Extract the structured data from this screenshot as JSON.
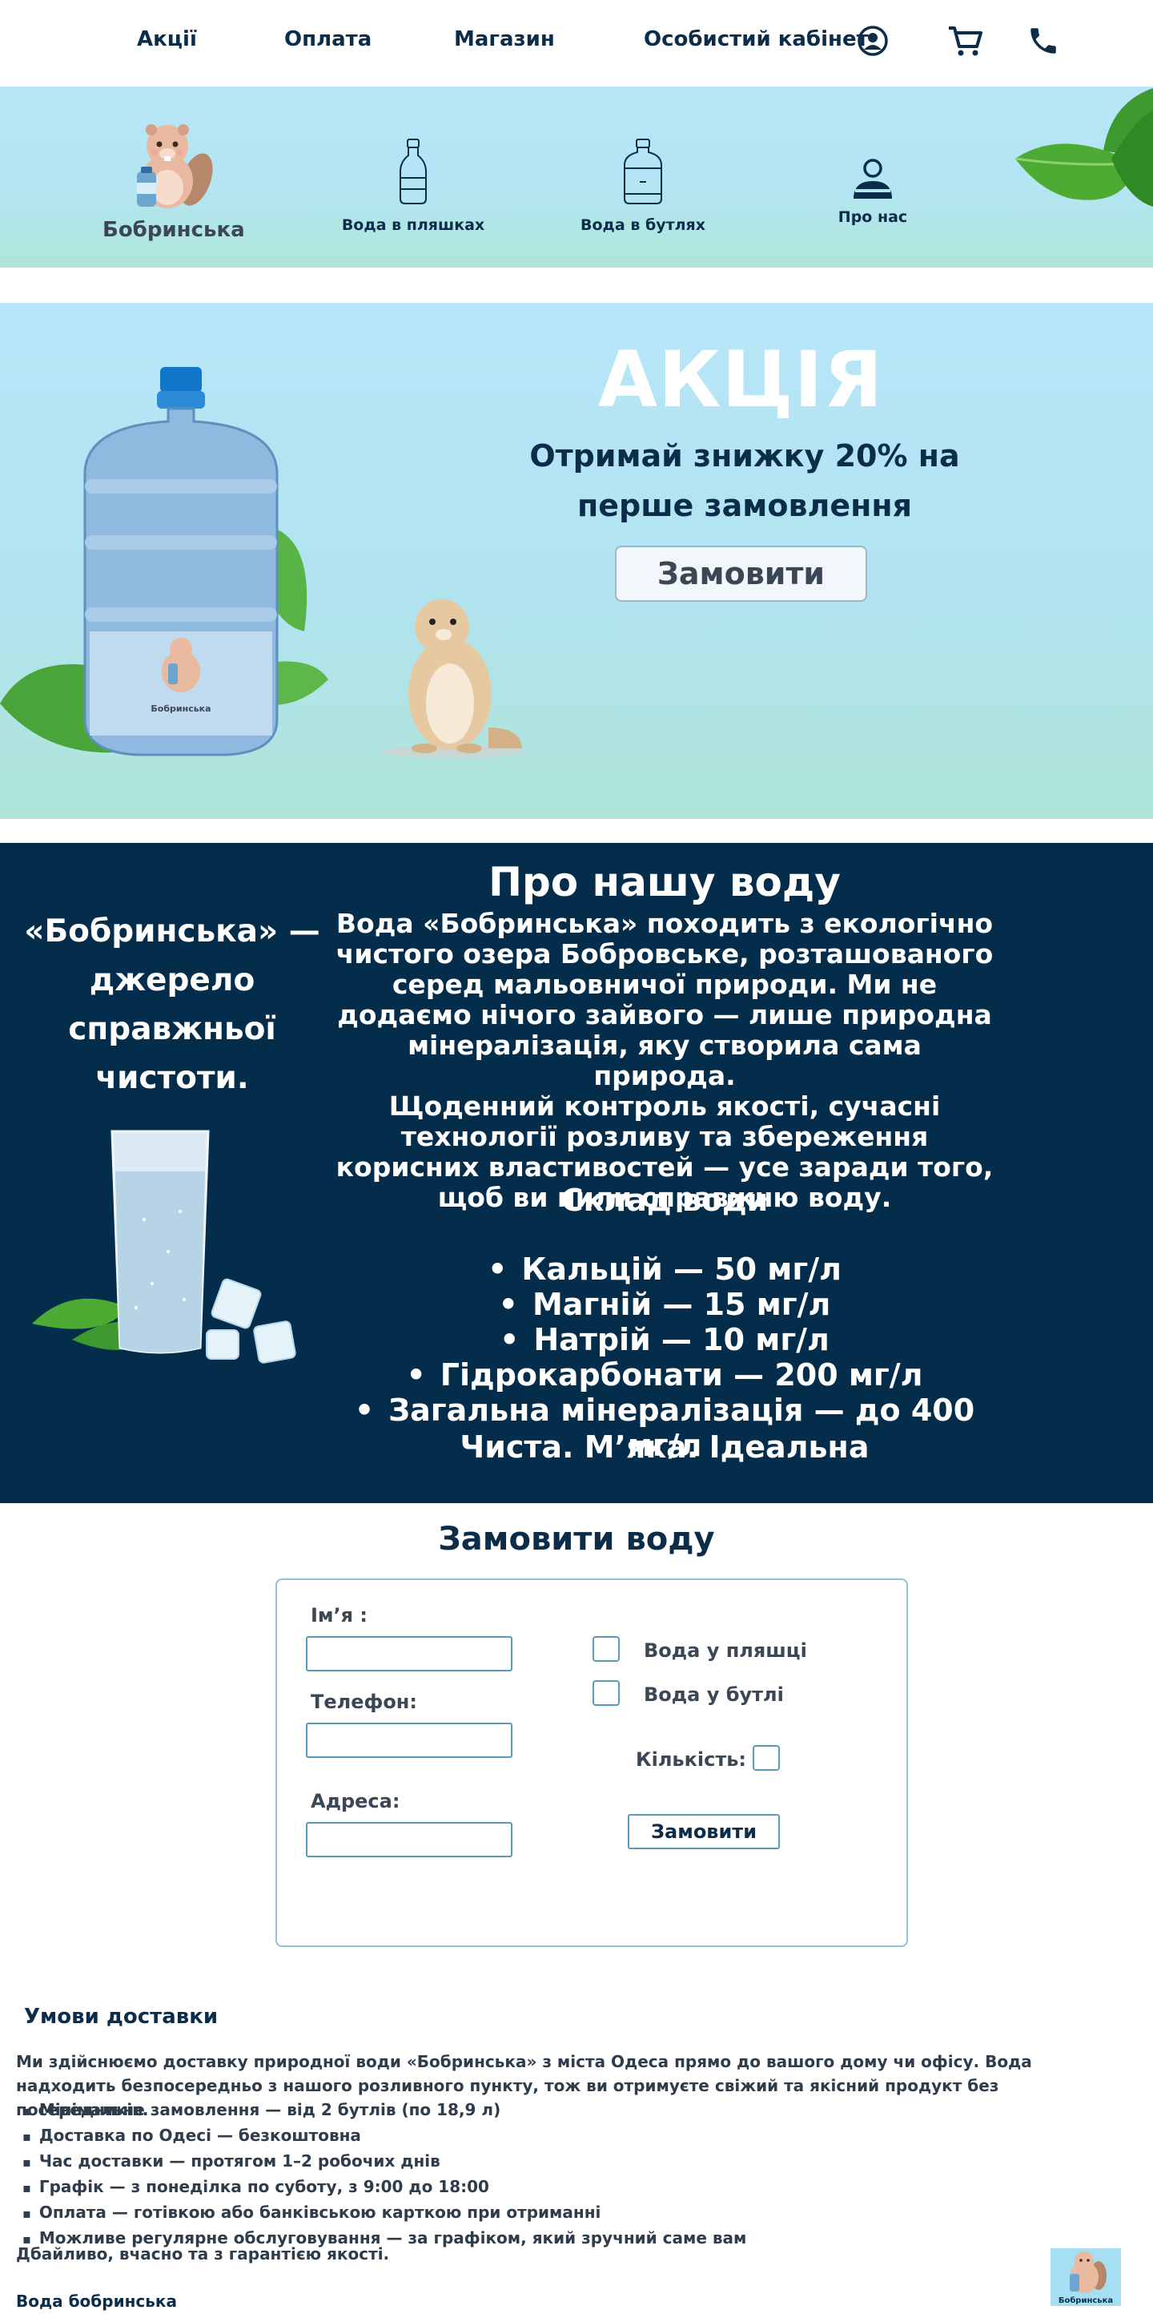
{
  "nav": {
    "links": [
      "Акції",
      "Оплата",
      "Магазин",
      "Особистий кабінет"
    ],
    "icons": [
      "account-icon",
      "cart-icon",
      "phone-icon"
    ]
  },
  "categories": {
    "brand": "Бобринська",
    "items": [
      "Вода в пляшках",
      "Вода в бутлях",
      "Про нас"
    ]
  },
  "promo": {
    "title": "АКЦІЯ",
    "text_line1": "Отримай знижку 20% на",
    "text_line2": "перше замовлення",
    "button": "Замовити",
    "bottle_label": "Бобринська"
  },
  "about": {
    "tagline": "«Бобринська» — джерело справжньої чистоти.",
    "title": "Про нашу воду",
    "paragraph1": "Вода «Бобринська» походить з екологічно чистого озера Бобровське, розташованого серед мальовничої природи. Ми не додаємо нічого зайвого — лише природна мінералізація, яку створила сама природа.",
    "paragraph2": "Щоденний контроль якості, сучасні технології розливу та збереження корисних властивостей — усе заради того, щоб ви пили справжню воду.",
    "composition_title": "Склад води",
    "composition": [
      "Кальцій — 50 мг/л",
      "Магній — 15 мг/л",
      "Натрій — 10 мг/л",
      "Гідрокарбонати — 200 мг/л",
      "Загальна мінералізація — до 400 мг/л"
    ],
    "slogan": "Чиста. М’яка. Ідеальна"
  },
  "order": {
    "title": "Замовити воду",
    "name_label": "Ім’я :",
    "phone_label": "Телефон:",
    "address_label": "Адреса:",
    "option_bottle": "Вода у пляшці",
    "option_jug": "Вода у бутлі",
    "quantity_label": "Кількість:",
    "submit": "Замовити",
    "name_value": "",
    "phone_value": "",
    "address_value": ""
  },
  "delivery": {
    "title": "Умови доставки",
    "intro": "Ми здійснюємо доставку природної води «Бобринська» з міста Одеса прямо до вашого дому чи офісу. Вода надходить безпосередньо з нашого розливного пункту, тож ви отримуєте свіжий та якісний продукт без посередників.",
    "items": [
      "Мінімальне замовлення — від 2 бутлів (по 18,9 л)",
      "Доставка по Одесі — безкоштовна",
      "Час доставки — протягом 1–2 робочих днів",
      "Графік — з понеділка по суботу, з 9:00 до 18:00",
      "Оплата — готівкою або банківською карткою при отриманні",
      "Можливе регулярне обслуговування — за графіком, який зручний саме вам"
    ],
    "outro": "Дбайливо, вчасно та з гарантією якості.",
    "footer_brand": "Вода бобринська",
    "footer_logo_label": "Бобринська"
  },
  "colors": {
    "navy": "#042d4b",
    "sky": "#b7e6f8",
    "mint": "#aee5d9",
    "input_border": "#5b9ab8"
  }
}
